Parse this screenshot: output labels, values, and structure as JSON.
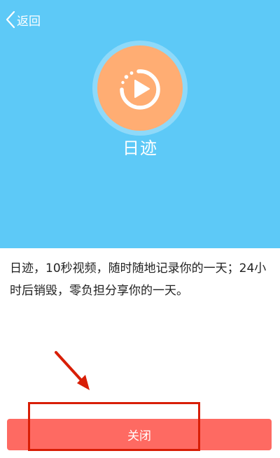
{
  "nav": {
    "back_label": "返回",
    "back_icon": "chevron-left-icon"
  },
  "app": {
    "title": "日迹",
    "icon": "play-circle-icon",
    "description": "日迹，10秒视频，随时随地记录你的一天；24小时后销毁，零负担分享你的一天。"
  },
  "actions": {
    "close_label": "关闭"
  },
  "colors": {
    "header_bg": "#5dc9f7",
    "icon_bg": "#ffad73",
    "button_bg": "#fe6a62",
    "annotation_red": "#d81e06"
  }
}
